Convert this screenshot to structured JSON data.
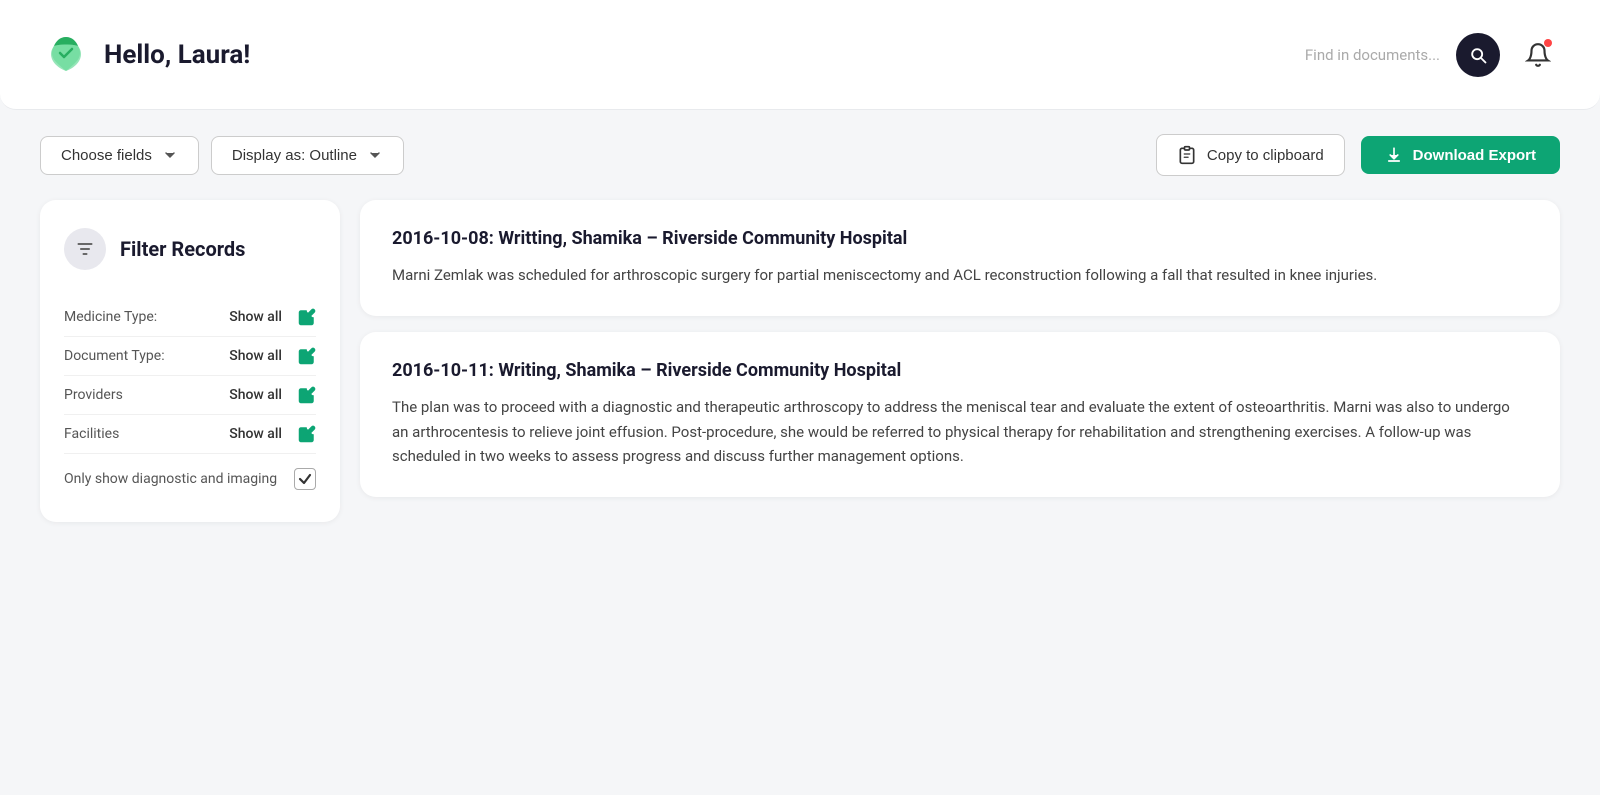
{
  "header": {
    "greeting": "Hello, Laura!",
    "search_placeholder": "Find in documents...",
    "search_icon": "search-icon",
    "bell_icon": "bell-icon",
    "logo_icon": "logo-icon"
  },
  "toolbar": {
    "choose_fields_label": "Choose fields",
    "display_as_label": "Display as: Outline",
    "copy_clipboard_label": "Copy to clipboard",
    "download_export_label": "Download Export"
  },
  "sidebar": {
    "title": "Filter Records",
    "filter_icon": "filter-icon",
    "filters": [
      {
        "label": "Medicine Type:",
        "value": "Show all"
      },
      {
        "label": "Document Type:",
        "value": "Show all"
      },
      {
        "label": "Providers",
        "value": "Show all"
      },
      {
        "label": "Facilities",
        "value": "Show all"
      }
    ],
    "checkbox_label": "Only show diagnostic and imaging",
    "checkbox_checked": true
  },
  "records": [
    {
      "title": "2016-10-08: Writting, Shamika – Riverside Community Hospital",
      "body": "Marni Zemlak was scheduled for arthroscopic surgery for partial meniscectomy and ACL reconstruction following a fall that resulted in knee injuries."
    },
    {
      "title": "2016-10-11: Writing, Shamika – Riverside Community Hospital",
      "body": "The plan was to proceed with a diagnostic and therapeutic arthroscopy to address the meniscal tear and evaluate the extent of osteoarthritis. Marni was also to undergo an arthrocentesis to relieve joint effusion. Post-procedure, she would be referred to physical therapy for rehabilitation and strengthening exercises. A follow-up was scheduled in two weeks to assess progress and discuss further management options."
    }
  ]
}
